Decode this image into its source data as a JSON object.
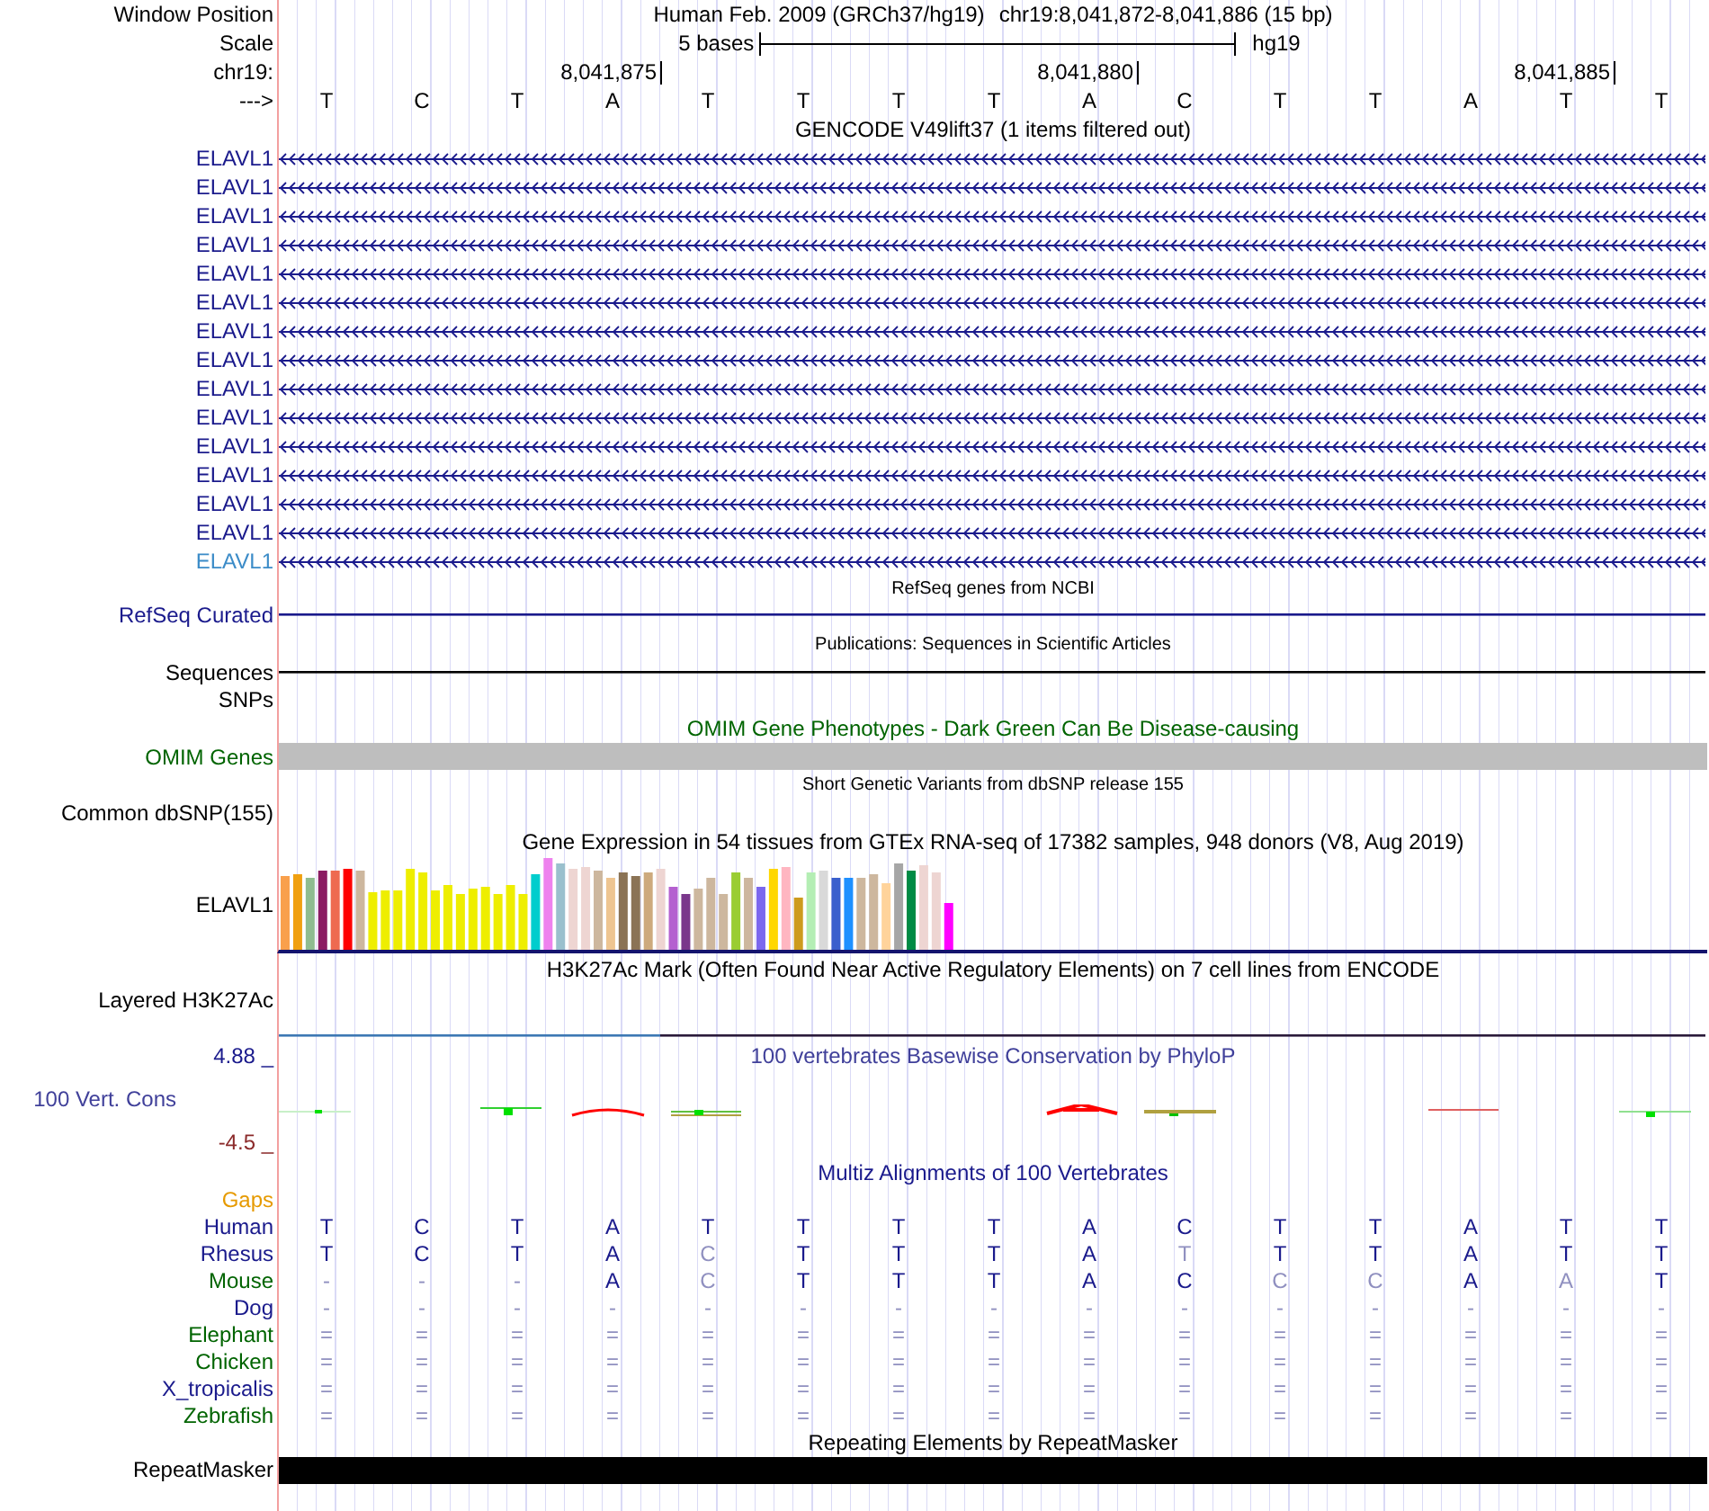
{
  "header": {
    "window_position_label": "Window Position",
    "assembly": "Human Feb. 2009 (GRCh37/hg19)",
    "position": "chr19:8,041,872-8,041,886 (15 bp)",
    "scale_label": "Scale",
    "scale_text": "5 bases",
    "scale_assembly": "hg19",
    "chrom_label": "chr19:",
    "strand_label": "--->"
  },
  "bases": [
    {
      "base": "T"
    },
    {
      "base": "C"
    },
    {
      "base": "T"
    },
    {
      "base": "A",
      "tick": "8,041,875"
    },
    {
      "base": "T"
    },
    {
      "base": "T"
    },
    {
      "base": "T"
    },
    {
      "base": "T"
    },
    {
      "base": "A",
      "tick": "8,041,880"
    },
    {
      "base": "C"
    },
    {
      "base": "T"
    },
    {
      "base": "T"
    },
    {
      "base": "A"
    },
    {
      "base": "T",
      "tick": "8,041,885"
    },
    {
      "base": "T"
    }
  ],
  "tracks": [
    {
      "kind": "genes",
      "title": "GENCODE V49lift37 (1 items filtered out)",
      "genes": [
        {
          "label": "ELAVL1",
          "color": "#1a1a8c"
        },
        {
          "label": "ELAVL1",
          "color": "#1a1a8c"
        },
        {
          "label": "ELAVL1",
          "color": "#1a1a8c"
        },
        {
          "label": "ELAVL1",
          "color": "#1a1a8c"
        },
        {
          "label": "ELAVL1",
          "color": "#1a1a8c"
        },
        {
          "label": "ELAVL1",
          "color": "#1a1a8c"
        },
        {
          "label": "ELAVL1",
          "color": "#1a1a8c"
        },
        {
          "label": "ELAVL1",
          "color": "#1a1a8c"
        },
        {
          "label": "ELAVL1",
          "color": "#1a1a8c"
        },
        {
          "label": "ELAVL1",
          "color": "#1a1a8c"
        },
        {
          "label": "ELAVL1",
          "color": "#1a1a8c"
        },
        {
          "label": "ELAVL1",
          "color": "#1a1a8c"
        },
        {
          "label": "ELAVL1",
          "color": "#1a1a8c"
        },
        {
          "label": "ELAVL1",
          "color": "#1a1a8c"
        },
        {
          "label": "ELAVL1",
          "color": "#3c8cc8"
        }
      ]
    },
    {
      "kind": "line",
      "title": "RefSeq genes from NCBI",
      "label": "RefSeq Curated",
      "color": "#1a1a8c"
    },
    {
      "kind": "line",
      "title": "Publications: Sequences in Scientific Articles",
      "label": "Sequences",
      "color": "#000000"
    },
    {
      "kind": "empty",
      "label": "SNPs",
      "color": "#000000"
    },
    {
      "kind": "omim",
      "title": "OMIM Gene Phenotypes - Dark Green Can Be Disease-causing",
      "label": "OMIM Genes",
      "color": "#006400"
    },
    {
      "kind": "empty",
      "title": "Short Genetic Variants from dbSNP release 155",
      "label": "Common dbSNP(155)",
      "color": "#000000"
    },
    {
      "kind": "expression",
      "title": "Gene Expression in 54 tissues from GTEx RNA-seq of 17382 samples, 948 donors (V8, Aug 2019)",
      "label": "ELAVL1",
      "color": "#000000"
    },
    {
      "kind": "layered",
      "title": "H3K27Ac Mark (Often Found Near Active Regulatory Elements) on 7 cell lines from ENCODE",
      "label": "Layered H3K27Ac",
      "color": "#000000"
    },
    {
      "kind": "wiggle",
      "title": "100 vertebrates Basewise Conservation by PhyloP",
      "label": "100 Vert. Cons",
      "color": "#40409a",
      "ymax": "4.88 _",
      "ymin": "-4.5 _"
    },
    {
      "kind": "alignment",
      "title": "Multiz Alignments of 100 Vertebrates",
      "gaps_label": "Gaps",
      "species": [
        {
          "name": "Human",
          "color": "#1a1a8c",
          "bases": [
            "T",
            "C",
            "T",
            "A",
            "T",
            "T",
            "T",
            "T",
            "A",
            "C",
            "T",
            "T",
            "A",
            "T",
            "T"
          ]
        },
        {
          "name": "Rhesus",
          "color": "#1a1a8c",
          "bases": [
            "T",
            "C",
            "T",
            "A",
            "C",
            "T",
            "T",
            "T",
            "A",
            "T",
            "T",
            "T",
            "A",
            "T",
            "T"
          ]
        },
        {
          "name": "Mouse",
          "color": "#006400",
          "bases": [
            "-",
            "-",
            "-",
            "A",
            "C",
            "T",
            "T",
            "T",
            "A",
            "C",
            "C",
            "C",
            "A",
            "A",
            "T"
          ]
        },
        {
          "name": "Dog",
          "color": "#1a1a8c",
          "bases": [
            "-",
            "-",
            "-",
            "-",
            "-",
            "-",
            "-",
            "-",
            "-",
            "-",
            "-",
            "-",
            "-",
            "-",
            "-"
          ]
        },
        {
          "name": "Elephant",
          "color": "#006400",
          "bases": [
            "=",
            "=",
            "=",
            "=",
            "=",
            "=",
            "=",
            "=",
            "=",
            "=",
            "=",
            "=",
            "=",
            "=",
            "="
          ]
        },
        {
          "name": "Chicken",
          "color": "#006400",
          "bases": [
            "=",
            "=",
            "=",
            "=",
            "=",
            "=",
            "=",
            "=",
            "=",
            "=",
            "=",
            "=",
            "=",
            "=",
            "="
          ]
        },
        {
          "name": "X_tropicalis",
          "color": "#1a1a8c",
          "bases": [
            "=",
            "=",
            "=",
            "=",
            "=",
            "=",
            "=",
            "=",
            "=",
            "=",
            "=",
            "=",
            "=",
            "=",
            "="
          ]
        },
        {
          "name": "Zebrafish",
          "color": "#006400",
          "bases": [
            "=",
            "=",
            "=",
            "=",
            "=",
            "=",
            "=",
            "=",
            "=",
            "=",
            "=",
            "=",
            "=",
            "=",
            "="
          ]
        }
      ]
    },
    {
      "kind": "repeats",
      "title": "Repeating Elements by RepeatMasker",
      "label": "RepeatMasker",
      "color": "#000000"
    }
  ]
}
